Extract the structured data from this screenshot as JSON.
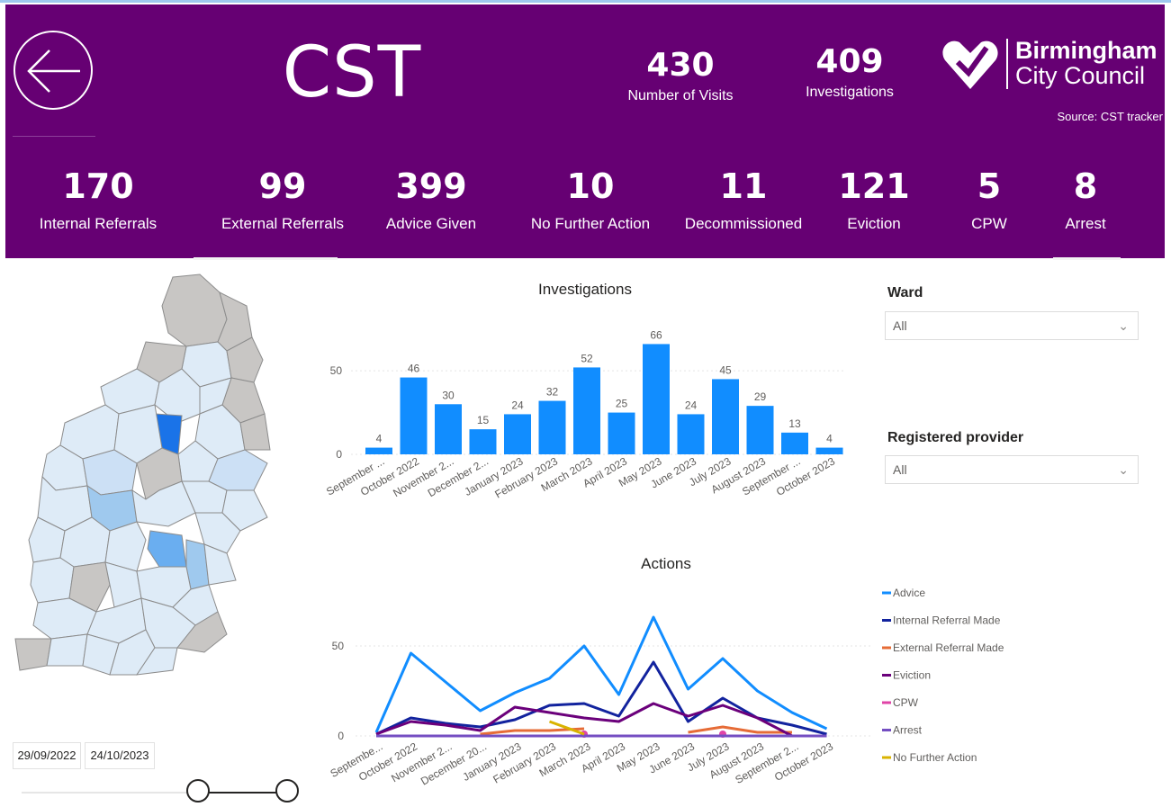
{
  "header": {
    "title": "CST",
    "visits": {
      "value": "430",
      "label": "Number of Visits"
    },
    "investigations": {
      "value": "409",
      "label": "Investigations"
    },
    "logo": {
      "line1": "Birmingham",
      "line2": "City Council"
    },
    "source": "Source: CST tracker"
  },
  "kpis": [
    {
      "value": "170",
      "label": "Internal Referrals"
    },
    {
      "value": "99",
      "label": "External Referrals"
    },
    {
      "value": "399",
      "label": "Advice Given"
    },
    {
      "value": "10",
      "label": "No Further Action"
    },
    {
      "value": "11",
      "label": "Decommissioned"
    },
    {
      "value": "121",
      "label": "Eviction"
    },
    {
      "value": "5",
      "label": "CPW"
    },
    {
      "value": "8",
      "label": "Arrest"
    }
  ],
  "date_range": {
    "start": "29/09/2022",
    "end": "24/10/2023"
  },
  "slicers": {
    "ward": {
      "title": "Ward",
      "value": "All"
    },
    "provider": {
      "title": "Registered provider",
      "value": "All"
    }
  },
  "colors": {
    "header_bg": "#660073",
    "bar": "#118dff"
  },
  "icons": {
    "back": "arrow-left-icon",
    "dropdown": "chevron-down-icon",
    "logo": "heart-logo-icon"
  },
  "chart_data": [
    {
      "type": "bar",
      "title": "Investigations",
      "categories": [
        "September ...",
        "October 2022",
        "November 2...",
        "December 2...",
        "January 2023",
        "February 2023",
        "March 2023",
        "April 2023",
        "May 2023",
        "June 2023",
        "July 2023",
        "August 2023",
        "September ...",
        "October 2023"
      ],
      "values": [
        4,
        46,
        30,
        15,
        24,
        32,
        52,
        25,
        66,
        24,
        45,
        29,
        13,
        4
      ],
      "yticks": [
        0,
        50
      ],
      "ylim": [
        0,
        70
      ],
      "data_labels": true,
      "color": "#118dff"
    },
    {
      "type": "line",
      "title": "Actions",
      "categories": [
        "Septembe...",
        "October 2022",
        "November 2...",
        "December 20...",
        "January 2023",
        "February 2023",
        "March 2023",
        "April 2023",
        "May 2023",
        "June 2023",
        "July 2023",
        "August 2023",
        "September 2...",
        "October 2023"
      ],
      "yticks": [
        0,
        50
      ],
      "ylim": [
        0,
        70
      ],
      "legend_position": "right",
      "series": [
        {
          "name": "Advice",
          "color": "#118dff",
          "values": [
            2,
            46,
            30,
            14,
            24,
            32,
            50,
            23,
            66,
            26,
            43,
            25,
            13,
            4
          ]
        },
        {
          "name": "Internal Referral Made",
          "color": "#12239e",
          "values": [
            1,
            10,
            7,
            5,
            9,
            17,
            18,
            11,
            41,
            8,
            21,
            10,
            6,
            1
          ]
        },
        {
          "name": "External Referral Made",
          "color": "#e66c37",
          "values": [
            null,
            null,
            null,
            1,
            3,
            3,
            4,
            null,
            null,
            2,
            5,
            2,
            2,
            null
          ]
        },
        {
          "name": "Eviction",
          "color": "#6b007b",
          "values": [
            1,
            8,
            6,
            3,
            16,
            13,
            10,
            8,
            18,
            11,
            17,
            10,
            0,
            null
          ]
        },
        {
          "name": "CPW",
          "color": "#e044a7",
          "values": [
            null,
            null,
            null,
            null,
            null,
            null,
            1,
            null,
            null,
            null,
            1,
            null,
            null,
            null
          ]
        },
        {
          "name": "Arrest",
          "color": "#744ec2",
          "values": [
            0,
            0,
            0,
            0,
            0,
            0,
            0,
            0,
            0,
            0,
            0,
            0,
            0,
            0
          ]
        },
        {
          "name": "No Further Action",
          "color": "#d9b300",
          "values": [
            null,
            null,
            null,
            null,
            null,
            8,
            1,
            null,
            null,
            null,
            null,
            null,
            null,
            null
          ]
        }
      ]
    }
  ]
}
